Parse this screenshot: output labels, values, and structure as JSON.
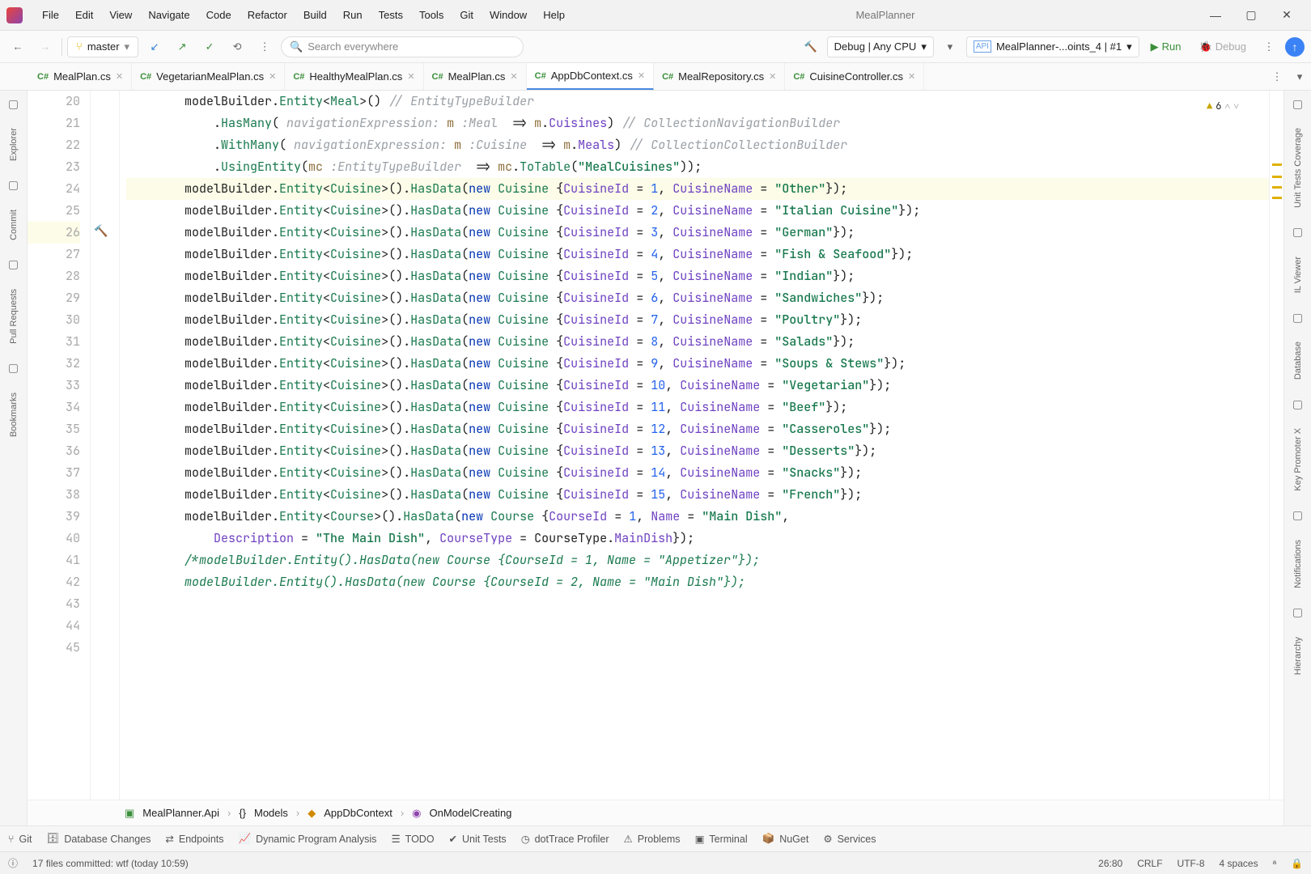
{
  "app_title": "MealPlanner",
  "menu": [
    "File",
    "Edit",
    "View",
    "Navigate",
    "Code",
    "Refactor",
    "Build",
    "Run",
    "Tests",
    "Tools",
    "Git",
    "Window",
    "Help"
  ],
  "branch": "master",
  "search_placeholder": "Search everywhere",
  "debug_config": "Debug | Any CPU",
  "run_config": "MealPlanner-...oints_4 | #1",
  "run_label": "Run",
  "debug_label": "Debug",
  "tabs": [
    {
      "label": "MealPlan.cs",
      "active": false
    },
    {
      "label": "VegetarianMealPlan.cs",
      "active": false
    },
    {
      "label": "HealthyMealPlan.cs",
      "active": false
    },
    {
      "label": "MealPlan.cs",
      "active": false
    },
    {
      "label": "AppDbContext.cs",
      "active": true
    },
    {
      "label": "MealRepository.cs",
      "active": false
    },
    {
      "label": "CuisineController.cs",
      "active": false
    }
  ],
  "left_rail": [
    "Explorer",
    "Commit",
    "Pull Requests",
    "Bookmarks"
  ],
  "right_rail": [
    "Unit Tests Coverage",
    "IL Viewer",
    "Database",
    "Key Promoter X",
    "Notifications",
    "Hierarchy"
  ],
  "warnings_count": "6",
  "breadcrumb": {
    "project": "MealPlanner.Api",
    "ns": "Models",
    "class": "AppDbContext",
    "method": "OnModelCreating"
  },
  "toolstrip": [
    "Git",
    "Database Changes",
    "Endpoints",
    "Dynamic Program Analysis",
    "TODO",
    "Unit Tests",
    "dotTrace Profiler",
    "Problems",
    "Terminal",
    "NuGet",
    "Services"
  ],
  "status": {
    "msg": "17 files committed: wtf (today 10:59)",
    "pos": "26:80",
    "eol": "CRLF",
    "enc": "UTF-8",
    "indent": "4 spaces"
  },
  "lines": {
    "start": 20,
    "end": 45
  },
  "code": {
    "l21_cmt": "// EntityTypeBuilder<Meal>",
    "l22_cmt": "// CollectionNavigationBuilder<Meal,Cuisine>",
    "l23_cmt": "// CollectionCollectionBuilder<Cuisine,Meal>",
    "l24_str": "\"MealCuisines\"",
    "l42_desc_label": "Description",
    "l43_desc": "\"The Main Dish\"",
    "l43_ct": "CourseType",
    "l43_ctv": "MainDish",
    "seed_cuisines": [
      {
        "id": "1",
        "name": "\"Other\""
      },
      {
        "id": "2",
        "name": "\"Italian Cuisine\""
      },
      {
        "id": "3",
        "name": "\"German\""
      },
      {
        "id": "4",
        "name": "\"Fish & Seafood\""
      },
      {
        "id": "5",
        "name": "\"Indian\""
      },
      {
        "id": "6",
        "name": "\"Sandwiches\""
      },
      {
        "id": "7",
        "name": "\"Poultry\""
      },
      {
        "id": "8",
        "name": "\"Salads\""
      },
      {
        "id": "9",
        "name": "\"Soups & Stews\""
      },
      {
        "id": "10",
        "name": "\"Vegetarian\""
      },
      {
        "id": "11",
        "name": "\"Beef\""
      },
      {
        "id": "12",
        "name": "\"Casseroles\""
      },
      {
        "id": "13",
        "name": "\"Desserts\""
      },
      {
        "id": "14",
        "name": "\"Snacks\""
      },
      {
        "id": "15",
        "name": "\"French\""
      }
    ],
    "course_seed": {
      "id": "1",
      "name": "\"Main Dish\""
    },
    "l44": "/*modelBuilder.Entity<Course>().HasData(new Course {CourseId = 1, Name = \"Appetizer\"});",
    "l45": "modelBuilder.Entity<Course>().HasData(new Course {CourseId = 2, Name = \"Main Dish\"});"
  }
}
